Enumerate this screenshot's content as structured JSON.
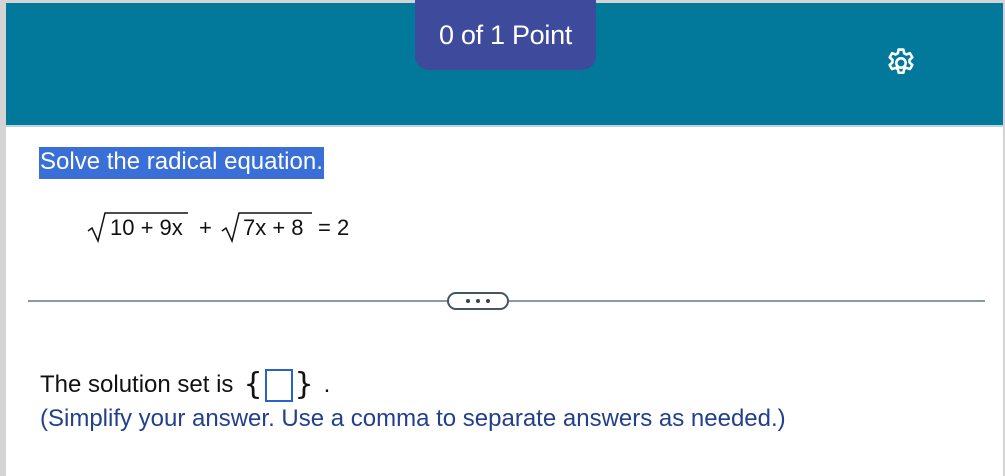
{
  "header": {
    "points_label": "0 of 1 Point",
    "settings_icon": "gear-icon"
  },
  "question": {
    "instruction": "Solve the radical equation.",
    "equation": {
      "radicand_1": "10 + 9x",
      "operator": "+",
      "radicand_2": "7x + 8",
      "rhs": "= 2"
    }
  },
  "divider": {
    "more_icon": "ellipsis-icon"
  },
  "answer": {
    "prefix": "The solution set is",
    "open_brace": "{",
    "close_brace": "}",
    "suffix": ".",
    "value": "",
    "hint": "(Simplify your answer. Use a comma to separate answers as needed.)"
  },
  "colors": {
    "header_bg": "#02789a",
    "points_tab_bg": "#3e4a9b",
    "highlight_bg": "#3a6fd8",
    "hint_text": "#23408e",
    "answer_box_border": "#2a62c9"
  }
}
